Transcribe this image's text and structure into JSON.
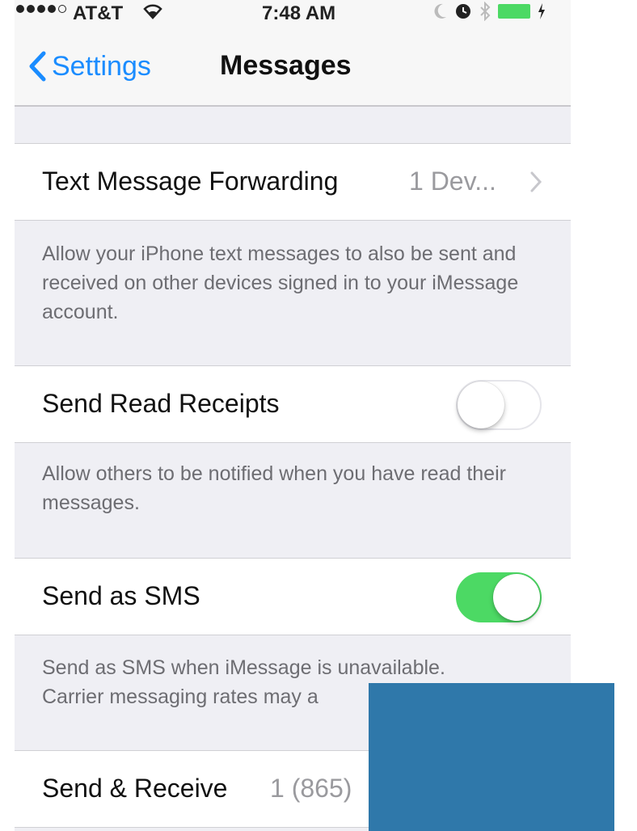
{
  "status_bar": {
    "carrier": "AT&T",
    "time": "7:48 AM",
    "signal_icon": "signal-dots-icon",
    "wifi_icon": "wifi-icon",
    "battery_icon": "battery-charging-icon",
    "battery_color": "#4cd964"
  },
  "nav": {
    "back_label": "Settings",
    "title": "Messages",
    "accent_color": "#1a8cff"
  },
  "settings": {
    "text_forwarding": {
      "label": "Text Message Forwarding",
      "value": "1 Dev...",
      "footer": "Allow your iPhone text messages to also be sent and received on other devices signed in to your iMessage account."
    },
    "read_receipts": {
      "label": "Send Read Receipts",
      "enabled": false,
      "footer": "Allow others to be notified when you have read their messages."
    },
    "send_as_sms": {
      "label": "Send as SMS",
      "enabled": true,
      "footer_line1": "Send as SMS when iMessage is unavailable.",
      "footer_line2": "Carrier messaging rates may a"
    },
    "send_receive": {
      "label": "Send & Receive",
      "value": "1 (865)"
    }
  },
  "colors": {
    "toggle_on": "#4cd964",
    "redaction": "#2f78aa"
  }
}
